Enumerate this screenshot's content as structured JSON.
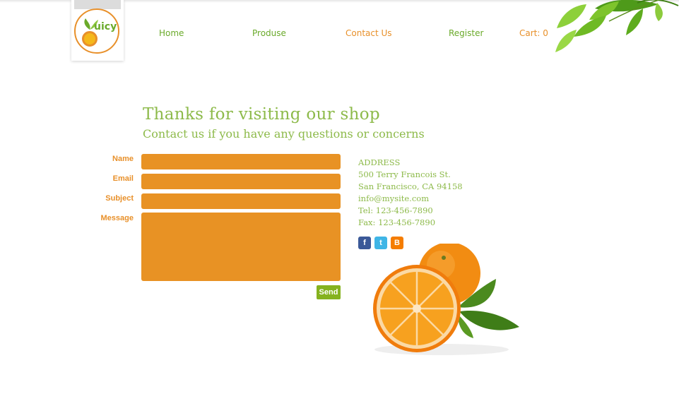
{
  "header": {
    "logo_text": "uicy",
    "nav": [
      {
        "label": "Home"
      },
      {
        "label": "Produse"
      },
      {
        "label": "Contact Us"
      },
      {
        "label": "Register"
      }
    ],
    "cart_label": "Cart: 0"
  },
  "main": {
    "title": "Thanks for visiting our shop",
    "subtitle": "Contact us if you have any questions or concerns"
  },
  "form": {
    "labels": {
      "name": "Name",
      "email": "Email",
      "subject": "Subject",
      "message": "Message"
    },
    "values": {
      "name": "",
      "email": "",
      "subject": "",
      "message": ""
    },
    "send_label": "Send"
  },
  "contact": {
    "heading": "ADDRESS",
    "street": "500 Terry Francois St.",
    "city": "San Francisco, CA 94158",
    "email": "info@mysite.com",
    "tel": "Tel: 123-456-7890",
    "fax": "Fax: 123-456-7890"
  },
  "social": [
    {
      "icon": "facebook-icon",
      "glyph": "f"
    },
    {
      "icon": "twitter-icon",
      "glyph": "t"
    },
    {
      "icon": "blogger-icon",
      "glyph": "B"
    }
  ],
  "colors": {
    "accent_orange": "#e8902a",
    "field_orange": "#e89224",
    "green": "#8dba4a",
    "send_green": "#85b21e"
  }
}
